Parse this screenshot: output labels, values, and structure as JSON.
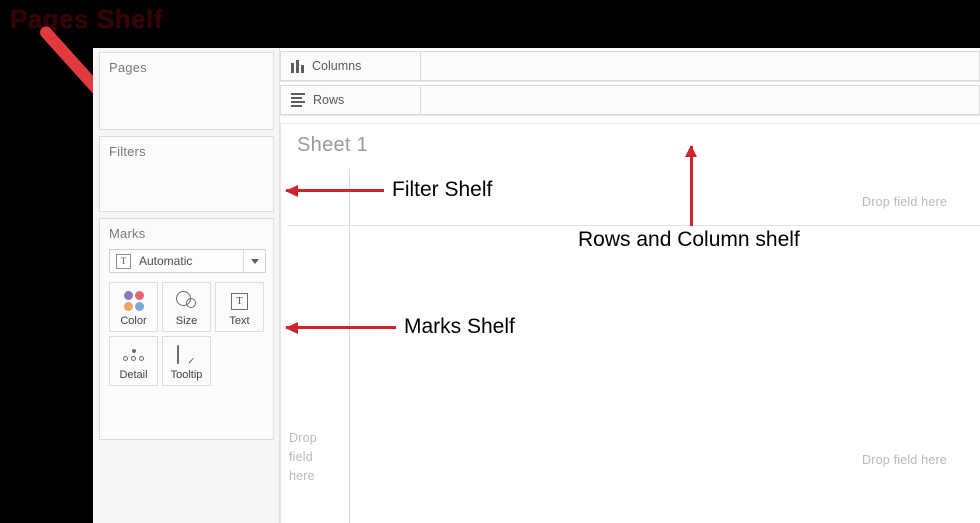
{
  "annotations": {
    "top_left_label": "Pages Shelf",
    "filter_shelf": "Filter Shelf",
    "marks_shelf": "Marks Shelf",
    "rows_columns_shelf": "Rows and Column shelf",
    "accent_color": "#d0232b"
  },
  "left_panel": {
    "pages": {
      "title": "Pages"
    },
    "filters": {
      "title": "Filters"
    },
    "marks": {
      "title": "Marks",
      "mark_type": {
        "value": "Automatic",
        "icon": "text-mark-icon",
        "caret": "chevron-down-icon"
      },
      "buttons": [
        {
          "label": "Color",
          "icon": "color-dots-icon"
        },
        {
          "label": "Size",
          "icon": "size-circles-icon"
        },
        {
          "label": "Text",
          "icon": "text-box-icon"
        },
        {
          "label": "Detail",
          "icon": "detail-dots-icon"
        },
        {
          "label": "Tooltip",
          "icon": "tooltip-bubble-icon"
        }
      ],
      "color_dots": [
        "#8c7bb8",
        "#e8676f",
        "#f5a35c",
        "#7fa8d4"
      ]
    }
  },
  "shelves": {
    "columns": {
      "label": "Columns",
      "icon": "columns-bars-icon"
    },
    "rows": {
      "label": "Rows",
      "icon": "rows-lines-icon"
    }
  },
  "sheet": {
    "title": "Sheet 1",
    "drop_hint_top_right": "Drop field here",
    "drop_hint_bottom_right": "Drop field here",
    "drop_hint_left": "Drop field here"
  }
}
